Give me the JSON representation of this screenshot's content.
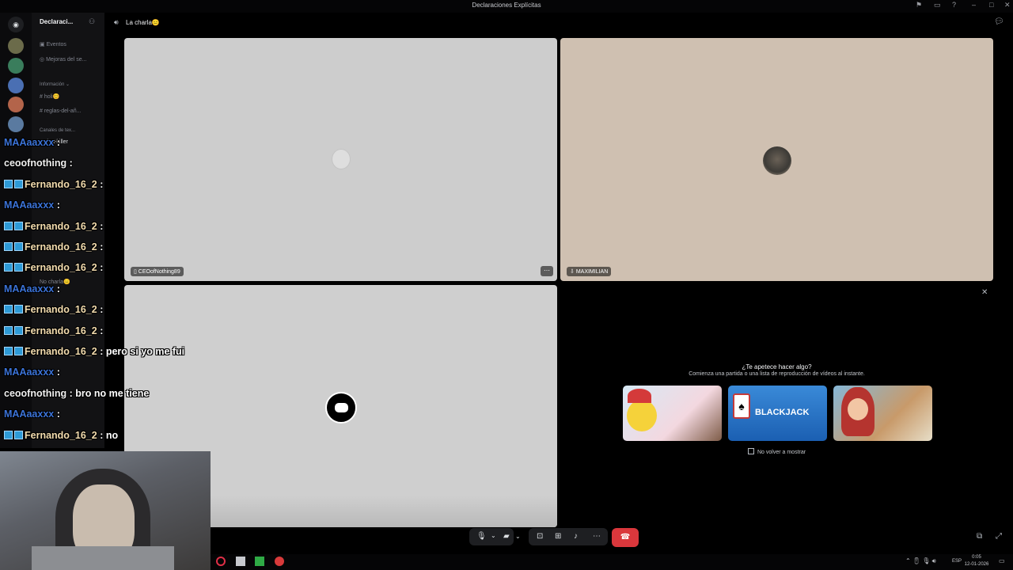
{
  "window": {
    "title": "Declaraciones Explícitas"
  },
  "server": {
    "name": "Declaraci..."
  },
  "channels": {
    "events": "Eventos",
    "boosts": "Mejoras del se...",
    "category": "Información",
    "items": [
      "holi😊",
      "reglas-del-añ..."
    ],
    "category2": "Canales de tex...",
    "chat": "chat-killer",
    "voice": "No charla😑"
  },
  "voice_channel": {
    "title": "La charla😑"
  },
  "participants": [
    {
      "name": "CEOofNothing89"
    },
    {
      "name": "MAXIMILIAN"
    },
    {
      "name": ""
    }
  ],
  "activity_prompt": {
    "title": "¿Te apetece hacer algo?",
    "subtitle": "Comienza una partida o una lista de reproducción de vídeos al instante.",
    "cards": [
      "",
      "BLACKJACK",
      ""
    ],
    "dont_show_label": "No volver a mostrar"
  },
  "stream_chat": [
    {
      "user": "MAAaaxxx",
      "text": "",
      "color": "#3b73d8"
    },
    {
      "user": "ceoofnothing",
      "text": "",
      "color": "#f0f0f0"
    },
    {
      "user": "Fernando_16_2",
      "text": "",
      "color": "#f3dcae",
      "badge": true
    },
    {
      "user": "MAAaaxxx",
      "text": "",
      "color": "#3b73d8"
    },
    {
      "user": "Fernando_16_2",
      "text": "",
      "color": "#f3dcae",
      "badge": true
    },
    {
      "user": "Fernando_16_2",
      "text": "",
      "color": "#f3dcae",
      "badge": true
    },
    {
      "user": "Fernando_16_2",
      "text": "",
      "color": "#f3dcae",
      "badge": true
    },
    {
      "user": "MAAaaxxx",
      "text": "",
      "color": "#3b73d8"
    },
    {
      "user": "Fernando_16_2",
      "text": "",
      "color": "#f3dcae",
      "badge": true
    },
    {
      "user": "Fernando_16_2",
      "text": "",
      "color": "#f3dcae",
      "badge": true
    },
    {
      "user": "Fernando_16_2",
      "text": "pero si yo me fui",
      "color": "#f3dcae",
      "badge": true
    },
    {
      "user": "MAAaaxxx",
      "text": "",
      "color": "#3b73d8"
    },
    {
      "user": "ceoofnothing",
      "text": "bro no me tiene",
      "color": "#f0f0f0"
    },
    {
      "user": "MAAaaxxx",
      "text": "",
      "color": "#3b73d8"
    },
    {
      "user": "Fernando_16_2",
      "text": "no",
      "color": "#f3dcae",
      "badge": true
    }
  ],
  "tray": {
    "lang": "ESP",
    "time": "0:05",
    "date": "12-01-2026"
  },
  "colors": {
    "hangup": "#da373c",
    "bg": "#000000"
  },
  "icons": [
    "discord-icon",
    "speaker-icon",
    "mic-icon",
    "camera-off-icon",
    "screen-share-icon",
    "activities-icon",
    "soundboard-icon",
    "more-icon",
    "hangup-icon",
    "close-icon"
  ]
}
